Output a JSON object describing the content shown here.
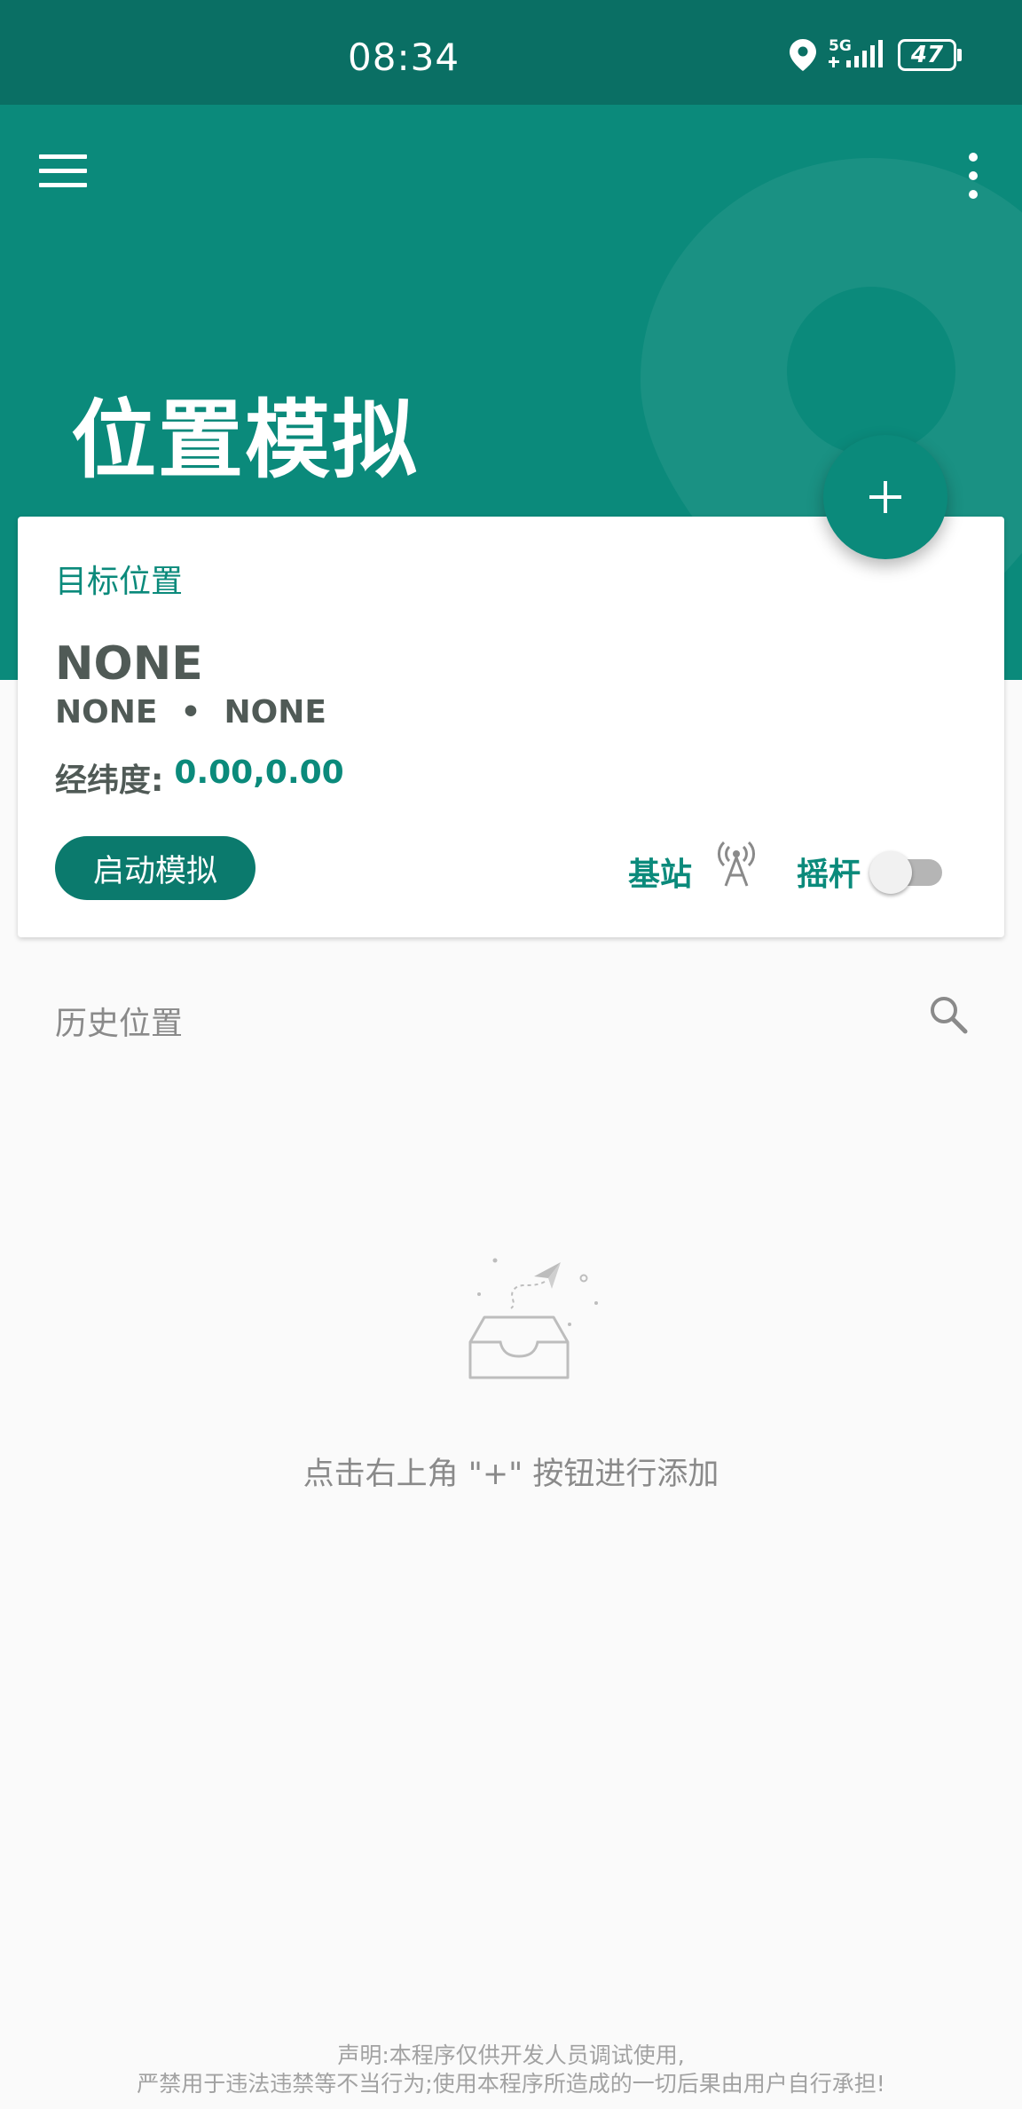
{
  "status_bar": {
    "time": "08:34",
    "network": "5G",
    "battery": "47",
    "icons": [
      "location-icon",
      "signal-icon",
      "battery-icon"
    ]
  },
  "app_bar": {
    "title": "位置模拟",
    "icons": [
      "menu-icon",
      "more-vert-icon"
    ]
  },
  "fab": {
    "icon": "plus-icon"
  },
  "target_card": {
    "label": "目标位置",
    "name": "NONE",
    "region": "NONE",
    "separator": "•",
    "city": "NONE",
    "coords_key": "经纬度:",
    "coords_value": "0.00,0.00",
    "start_button": "启动模拟",
    "base_station_label": "基站",
    "base_station_icon": "cell-tower-icon",
    "joystick_label": "摇杆",
    "joystick_enabled": false
  },
  "history": {
    "label": "历史位置",
    "search_icon": "search-icon",
    "empty_icon": "empty-inbox-paper-plane-icon",
    "empty_text": "点击右上角 \"+\" 按钮进行添加"
  },
  "disclaimer": {
    "line1": "声明:本程序仅供开发人员调试使用,",
    "line2": "严禁用于违法违禁等不当行为;使用本程序所造成的一切后果由用户自行承担!"
  },
  "colors": {
    "primary": "#0b8a7b",
    "primary_dark": "#0a6f64",
    "background": "#fafafa"
  }
}
